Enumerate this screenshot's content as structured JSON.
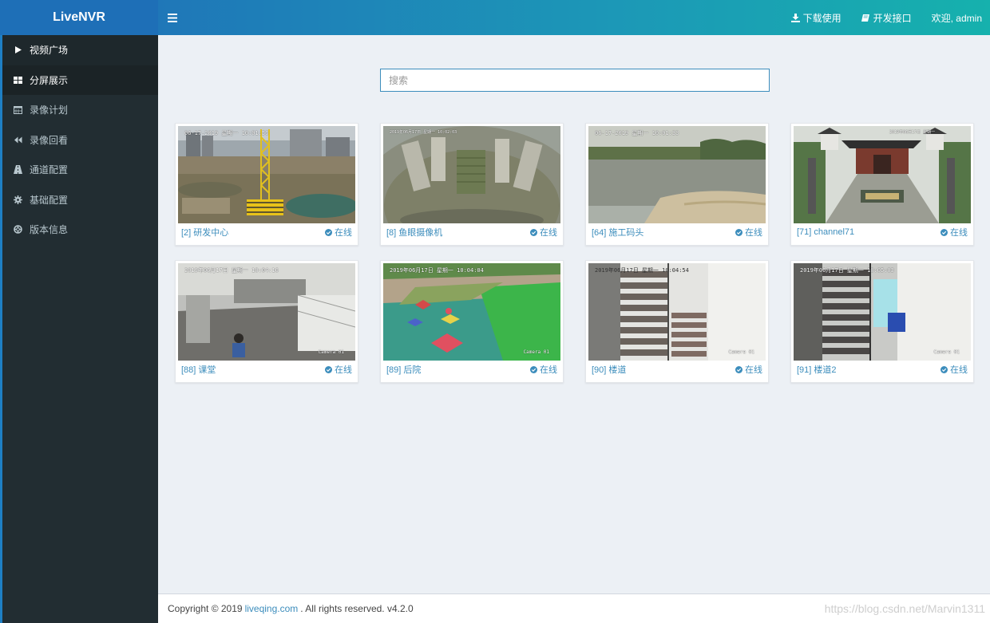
{
  "app": {
    "logo": "LiveNVR"
  },
  "header": {
    "download_label": "下载使用",
    "api_label": "开发接口",
    "welcome_label": "欢迎, admin"
  },
  "sidebar": {
    "items": [
      {
        "label": "视频广场",
        "icon": "play-icon"
      },
      {
        "label": "分屏展示",
        "icon": "grid-icon"
      },
      {
        "label": "录像计划",
        "icon": "calendar-icon"
      },
      {
        "label": "录像回看",
        "icon": "backward-icon"
      },
      {
        "label": "通道配置",
        "icon": "road-icon"
      },
      {
        "label": "基础配置",
        "icon": "gear-icon"
      },
      {
        "label": "版本信息",
        "icon": "lifebuoy-icon"
      }
    ]
  },
  "search": {
    "placeholder": "搜索"
  },
  "channels": [
    {
      "name": "[2] 研发中心",
      "status": "在线",
      "osd": "06-17-2019 星期一 10:01:56",
      "cam": ""
    },
    {
      "name": "[8] 鱼眼摄像机",
      "status": "在线",
      "osd": "2019年06月17日 星期一 10:02:03",
      "cam": ""
    },
    {
      "name": "[64] 施工码头",
      "status": "在线",
      "osd": "06-17-2019 星期一 10:01:33",
      "cam": ""
    },
    {
      "name": "[71] channel71",
      "status": "在线",
      "osd": "2019年06月17日 星期一",
      "cam": ""
    },
    {
      "name": "[88] 课堂",
      "status": "在线",
      "osd": "2019年06月17日 星期一 10:04:16",
      "cam": "Camera 01"
    },
    {
      "name": "[89] 后院",
      "status": "在线",
      "osd": "2019年06月17日 星期一 10:04:04",
      "cam": "Camera 01"
    },
    {
      "name": "[90] 楼道",
      "status": "在线",
      "osd": "2019年06月17日 星期一 10:04:54",
      "cam": "Camera 01"
    },
    {
      "name": "[91] 楼道2",
      "status": "在线",
      "osd": "2019年06月17日 星期一 10:05:03",
      "cam": "Camera 01"
    }
  ],
  "footer": {
    "copyright": "Copyright © 2019",
    "link": "liveqing.com",
    "rights": ". All rights reserved. v4.2.0",
    "watermark": "https://blog.csdn.net/Marvin1311"
  },
  "colors": {
    "accent": "#3c8dbc",
    "sidebar": "#222d32",
    "logo_bg": "#1e6fb7"
  }
}
